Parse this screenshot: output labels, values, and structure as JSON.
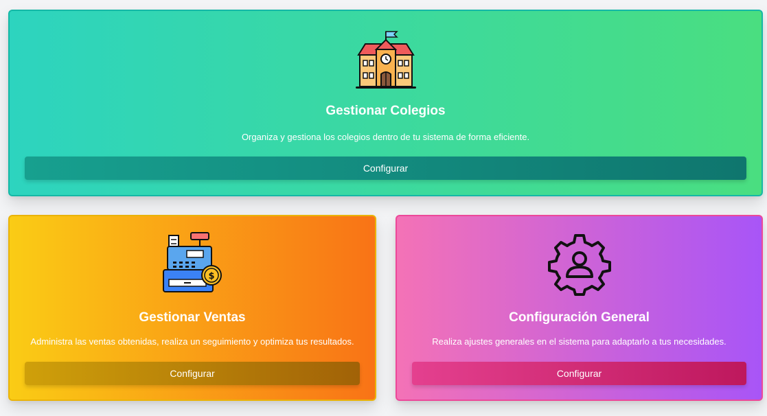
{
  "cards": [
    {
      "title": "Gestionar Colegios",
      "description": "Organiza y gestiona los colegios dentro de tu sistema de forma eficiente.",
      "button_label": "Configurar",
      "icon": "school-icon",
      "colors": {
        "gradient_start": "#2dd4bf",
        "gradient_end": "#4ade80",
        "border": "#14b8a6",
        "button": "#0f766e"
      }
    },
    {
      "title": "Gestionar Ventas",
      "description": "Administra las ventas obtenidas, realiza un seguimiento y optimiza tus resultados.",
      "button_label": "Configurar",
      "icon": "cash-register-icon",
      "colors": {
        "gradient_start": "#facc15",
        "gradient_end": "#f97316",
        "border": "#eab308",
        "button": "#a16207"
      }
    },
    {
      "title": "Configuración General",
      "description": "Realiza ajustes generales en el sistema para adaptarlo a tus necesidades.",
      "button_label": "Configurar",
      "icon": "user-gear-icon",
      "colors": {
        "gradient_start": "#f472b6",
        "gradient_end": "#a855f7",
        "border": "#ec4899",
        "button": "#be185d"
      }
    }
  ]
}
